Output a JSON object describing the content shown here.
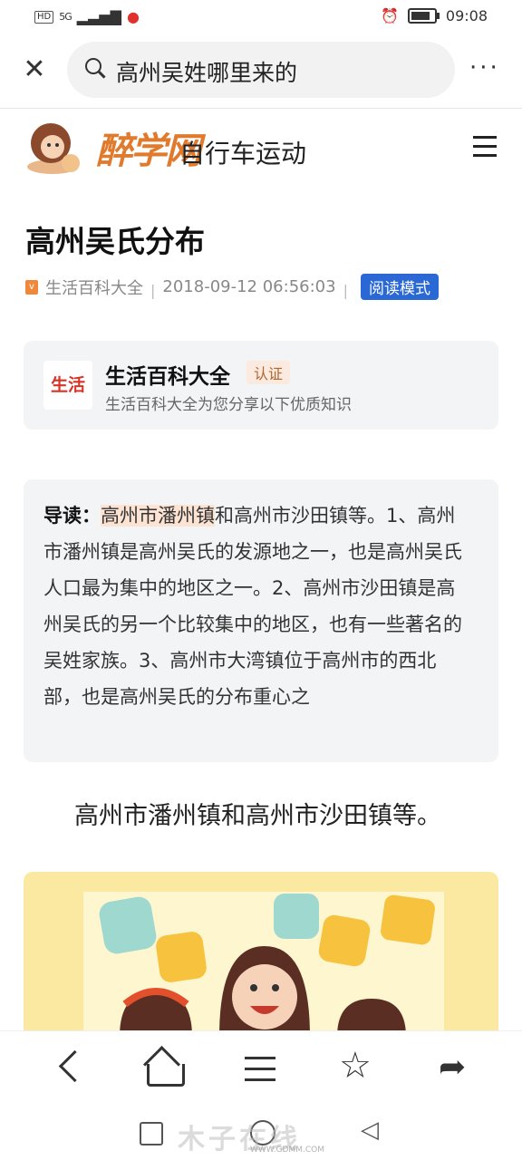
{
  "status_bar": {
    "hd": "HD",
    "signal": "5G",
    "time": "09:08"
  },
  "search": {
    "query": "高州吴姓哪里来的"
  },
  "site": {
    "logo_text": "醉学网",
    "section_title": "自行车运动"
  },
  "article": {
    "title": "高州吴氏分布",
    "source": "生活百科大全",
    "date": "2018-09-12 06:56:03",
    "read_mode": "阅读模式"
  },
  "author": {
    "logo_text": "生活",
    "name": "生活百科大全",
    "badge": "认证",
    "desc": "生活百科大全为您分享以下优质知识"
  },
  "guide": {
    "label": "导读：",
    "highlight": "高州市潘州镇",
    "text": "和高州市沙田镇等。1、高州市潘州镇是高州吴氏的发源地之一，也是高州吴氏人口最为集中的地区之一。2、高州市沙田镇是高州吴氏的另一个比较集中的地区，也有一些著名的吴姓家族。3、高州市大湾镇位于高州市的西北部，也是高州吴氏的分布重心之"
  },
  "body": {
    "paragraph": "高州市潘州镇和高州市沙田镇等。"
  },
  "watermark": {
    "text": "木子在线",
    "url": "WWW.GDMM.COM"
  },
  "colors": {
    "accent_blue": "#2a68d6",
    "logo_orange": "#e07a2c",
    "brand_red": "#d83426",
    "card_bg": "#f3f4f6"
  }
}
